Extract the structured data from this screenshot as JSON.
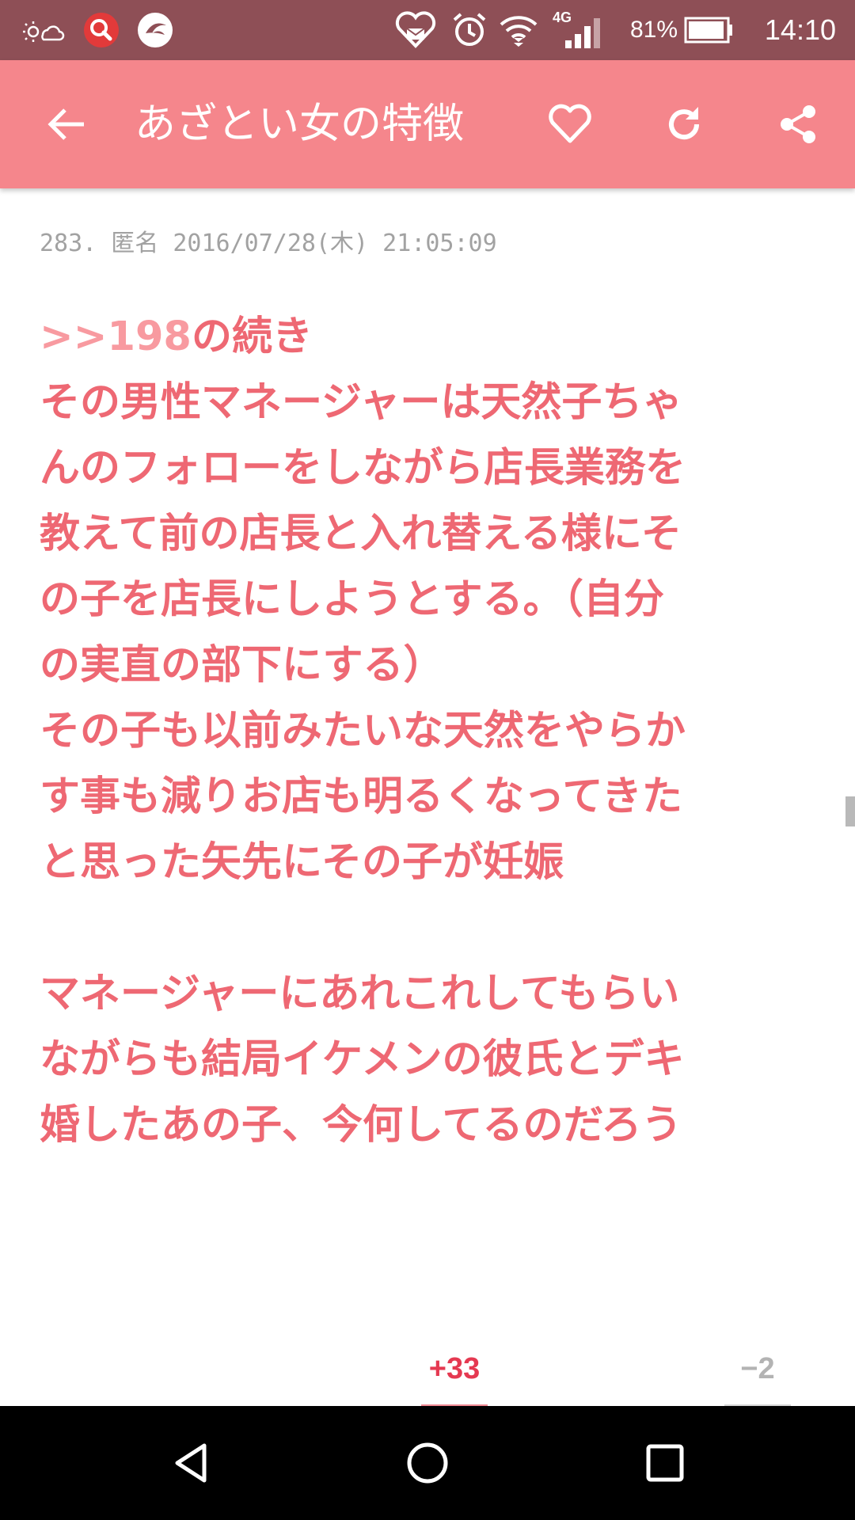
{
  "status_bar": {
    "battery_percent": "81%",
    "time": "14:10",
    "network_label": "4G"
  },
  "app_bar": {
    "title": "あざとい女の特徴"
  },
  "comment": {
    "meta": "283. 匿名 2016/07/28(木) 21:05:09",
    "anchor": ">>198",
    "anchor_suffix": "の続き",
    "lines": [
      "その男性マネージャーは天然子ちゃ",
      "んのフォローをしながら店長業務を",
      "教えて前の店長と入れ替える様にそ",
      "の子を店長にしようとする。（自分",
      "の実直の部下にする）",
      "その子も以前みたいな天然をやらか",
      "す事も減りお店も明るくなってきた",
      "と思った矢先にその子が妊娠",
      "",
      "マネージャーにあれこれしてもらい",
      "ながらも結局イケメンの彼氏とデキ",
      "婚したあの子、今何してるのだろう"
    ]
  },
  "votes": {
    "plus": "+33",
    "minus": "−2"
  },
  "colors": {
    "status_bar": "#8e4f56",
    "app_bar": "#f5868c",
    "body_text": "#ee6873",
    "anchor": "#f89aa0",
    "plus_vote": "#e53951",
    "minus_vote": "#b3b3b3"
  },
  "icons": {
    "status_left": [
      "weather-icon",
      "search-app-icon",
      "app-swirl-icon"
    ],
    "status_right": [
      "heart-notification-icon",
      "alarm-icon",
      "wifi-icon",
      "signal-icon",
      "battery-icon"
    ],
    "app_bar": [
      "back-arrow-icon",
      "heart-outline-icon",
      "refresh-icon",
      "share-icon"
    ],
    "nav": [
      "back-triangle-icon",
      "home-circle-icon",
      "recents-square-icon"
    ]
  }
}
